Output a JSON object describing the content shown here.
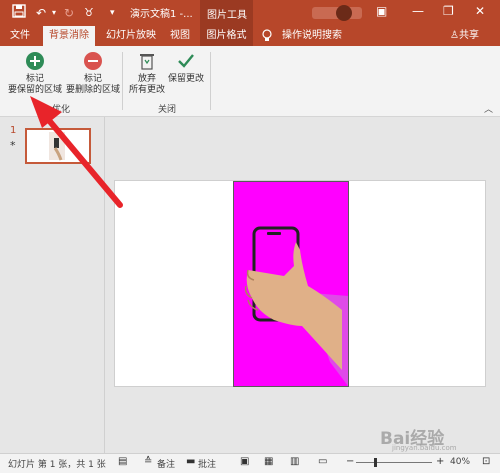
{
  "titlebar": {
    "title": "演示文稿1  -...",
    "context_group": "图片工具",
    "buttons": {
      "save": "save-icon",
      "undo": "undo-icon",
      "redo": "redo-icon",
      "minimize": "—",
      "restore": "❐",
      "close": "✕",
      "ribbon_display": "▣"
    }
  },
  "tabs": {
    "file": "文件",
    "background_removal": "背景消除",
    "slideshow": "幻灯片放映",
    "view": "视图",
    "picture_format": "图片格式",
    "tell_me": "操作说明搜索",
    "share": "共享"
  },
  "ribbon": {
    "mark_keep_line1": "标记",
    "mark_keep_line2": "要保留的区域",
    "mark_remove_line1": "标记",
    "mark_remove_line2": "要删除的区域",
    "discard_line1": "放弃",
    "discard_line2": "所有更改",
    "keep_changes": "保留更改",
    "group_refine": "优化",
    "group_close": "关闭"
  },
  "thumbnails": {
    "slide_number": "1",
    "star": "*"
  },
  "statusbar": {
    "slide_info": "幻灯片 第 1 张，共 1 张",
    "notes": "备注",
    "comments": "批注",
    "zoom": "40%"
  },
  "watermark": {
    "text": "Bai经验",
    "sub": "jingyan.baidu.com"
  },
  "colors": {
    "accent": "#b7472a",
    "photo_bg": "#ff00ff",
    "arrow": "#e8242a",
    "add": "#2e8b57",
    "remove": "#d9534f"
  }
}
